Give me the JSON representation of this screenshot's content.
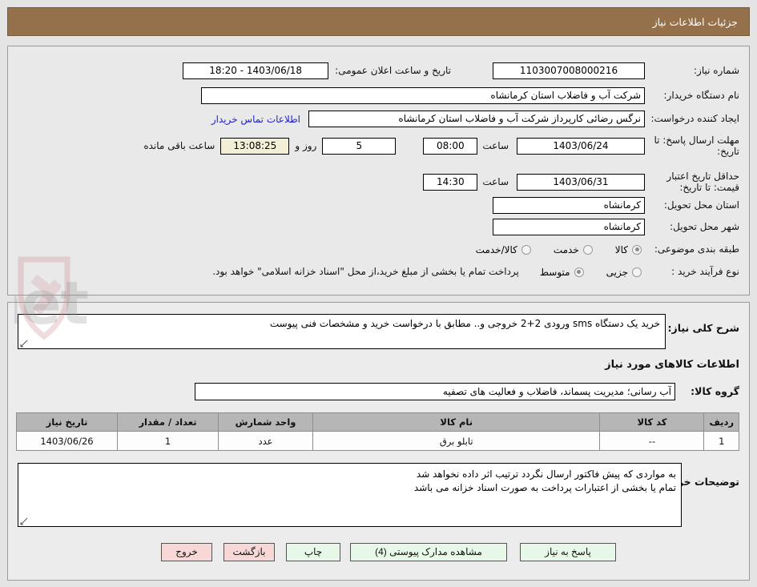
{
  "window": {
    "title": "جزئیات اطلاعات نیاز",
    "title_bg": "#94714a"
  },
  "watermark": {
    "text": "AriaTender.net",
    "logo": "shield-gavel-icon"
  },
  "form": {
    "need_number": {
      "label": "شماره نیاز:",
      "value": "1103007008000216"
    },
    "announce_datetime": {
      "label": "تاریخ و ساعت اعلان عمومی:",
      "value": "1403/06/18 - 18:20"
    },
    "buyer_org": {
      "label": "نام دستگاه خریدار:",
      "value": "شرکت آب و فاضلاب استان کرمانشاه"
    },
    "requester": {
      "label": "ایجاد کننده درخواست:",
      "value": "نرگس رضائی کارپرداز شرکت آب و فاضلاب استان کرمانشاه"
    },
    "contact_link": "اطلاعات تماس خریدار",
    "reply_deadline": {
      "label": "مهلت ارسال پاسخ: تا تاریخ:",
      "date": "1403/06/24",
      "time_label": "ساعت",
      "time": "08:00",
      "days_value": "5",
      "days_label": "روز و",
      "countdown": "13:08:25",
      "remaining_label": "ساعت باقی مانده"
    },
    "price_validity": {
      "label": "حداقل تاریخ اعتبار قیمت: تا تاریخ:",
      "date": "1403/06/31",
      "time_label": "ساعت",
      "time": "14:30"
    },
    "delivery_province": {
      "label": "استان محل تحویل:",
      "value": "کرمانشاه"
    },
    "delivery_city": {
      "label": "شهر محل تحویل:",
      "value": "کرمانشاه"
    },
    "category": {
      "label": "طبقه بندی موضوعی:",
      "options": [
        {
          "label": "کالا",
          "selected": true
        },
        {
          "label": "خدمت",
          "selected": false
        },
        {
          "label": "کالا/خدمت",
          "selected": false
        }
      ]
    },
    "process_type": {
      "label": "نوع فرآیند خرید :",
      "options": [
        {
          "label": "جزیی",
          "selected": false
        },
        {
          "label": "متوسط",
          "selected": true
        }
      ],
      "note": "پرداخت تمام یا بخشی از مبلغ خرید،از محل \"اسناد خزانه اسلامی\" خواهد بود."
    }
  },
  "details": {
    "summary_label": "شرح کلی نیاز:",
    "summary_value": "خرید یک دستگاه sms ورودی 2+2 خروجی و.. مطابق با درخواست خرید و مشخصات فنی پیوست",
    "goods_heading": "اطلاعات کالاهای مورد نیاز",
    "goods_group_label": "گروه کالا:",
    "goods_group_value": "آب رسانی؛ مدیریت پسماند، فاضلاب و فعالیت های تصفیه",
    "table": {
      "headers": [
        "ردیف",
        "کد کالا",
        "نام کالا",
        "واحد شمارش",
        "تعداد / مقدار",
        "تاریخ نیاز"
      ],
      "rows": [
        [
          "1",
          "--",
          "تابلو برق",
          "عدد",
          "1",
          "1403/06/26"
        ]
      ]
    },
    "notes_label": "توضیحات خریدار:",
    "notes_lines": [
      "به مواردی که پیش فاکتور ارسال نگردد ترتیب اثر داده نخواهد شد",
      "تمام یا بخشی از اعتبارات پرداخت به صورت اسناد خزانه می باشد"
    ]
  },
  "buttons": [
    {
      "label": "پاسخ به نیاز",
      "style": "green",
      "name": "respond-to-need-button"
    },
    {
      "label": "مشاهده مدارک پیوستی (4)",
      "style": "green",
      "name": "view-attachments-button"
    },
    {
      "label": "چاپ",
      "style": "green",
      "name": "print-button"
    },
    {
      "label": "بازگشت",
      "style": "red",
      "name": "back-button"
    },
    {
      "label": "خروج",
      "style": "red",
      "name": "exit-button"
    }
  ]
}
